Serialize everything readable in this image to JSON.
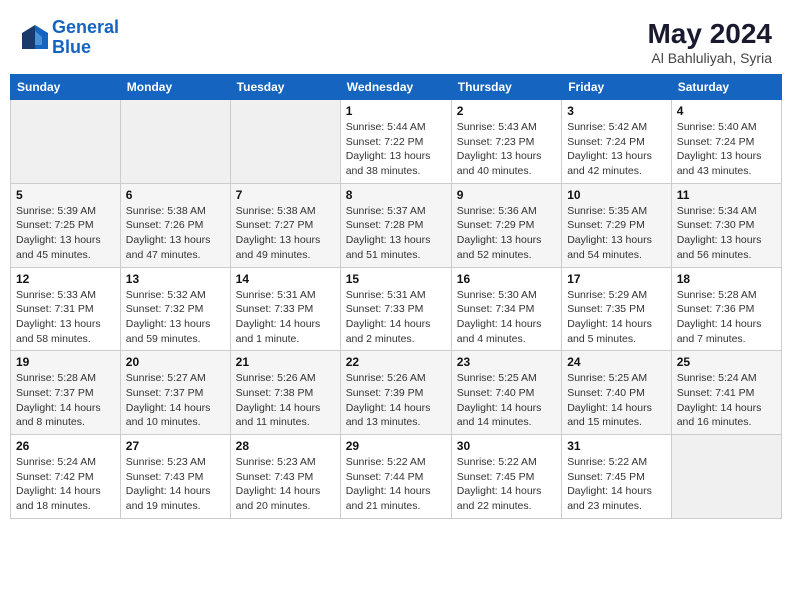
{
  "header": {
    "logo_line1": "General",
    "logo_line2": "Blue",
    "month_year": "May 2024",
    "location": "Al Bahluliyah, Syria"
  },
  "days_of_week": [
    "Sunday",
    "Monday",
    "Tuesday",
    "Wednesday",
    "Thursday",
    "Friday",
    "Saturday"
  ],
  "weeks": [
    [
      {
        "day": "",
        "sunrise": "",
        "sunset": "",
        "daylight": ""
      },
      {
        "day": "",
        "sunrise": "",
        "sunset": "",
        "daylight": ""
      },
      {
        "day": "",
        "sunrise": "",
        "sunset": "",
        "daylight": ""
      },
      {
        "day": "1",
        "sunrise": "Sunrise: 5:44 AM",
        "sunset": "Sunset: 7:22 PM",
        "daylight": "Daylight: 13 hours and 38 minutes."
      },
      {
        "day": "2",
        "sunrise": "Sunrise: 5:43 AM",
        "sunset": "Sunset: 7:23 PM",
        "daylight": "Daylight: 13 hours and 40 minutes."
      },
      {
        "day": "3",
        "sunrise": "Sunrise: 5:42 AM",
        "sunset": "Sunset: 7:24 PM",
        "daylight": "Daylight: 13 hours and 42 minutes."
      },
      {
        "day": "4",
        "sunrise": "Sunrise: 5:40 AM",
        "sunset": "Sunset: 7:24 PM",
        "daylight": "Daylight: 13 hours and 43 minutes."
      }
    ],
    [
      {
        "day": "5",
        "sunrise": "Sunrise: 5:39 AM",
        "sunset": "Sunset: 7:25 PM",
        "daylight": "Daylight: 13 hours and 45 minutes."
      },
      {
        "day": "6",
        "sunrise": "Sunrise: 5:38 AM",
        "sunset": "Sunset: 7:26 PM",
        "daylight": "Daylight: 13 hours and 47 minutes."
      },
      {
        "day": "7",
        "sunrise": "Sunrise: 5:38 AM",
        "sunset": "Sunset: 7:27 PM",
        "daylight": "Daylight: 13 hours and 49 minutes."
      },
      {
        "day": "8",
        "sunrise": "Sunrise: 5:37 AM",
        "sunset": "Sunset: 7:28 PM",
        "daylight": "Daylight: 13 hours and 51 minutes."
      },
      {
        "day": "9",
        "sunrise": "Sunrise: 5:36 AM",
        "sunset": "Sunset: 7:29 PM",
        "daylight": "Daylight: 13 hours and 52 minutes."
      },
      {
        "day": "10",
        "sunrise": "Sunrise: 5:35 AM",
        "sunset": "Sunset: 7:29 PM",
        "daylight": "Daylight: 13 hours and 54 minutes."
      },
      {
        "day": "11",
        "sunrise": "Sunrise: 5:34 AM",
        "sunset": "Sunset: 7:30 PM",
        "daylight": "Daylight: 13 hours and 56 minutes."
      }
    ],
    [
      {
        "day": "12",
        "sunrise": "Sunrise: 5:33 AM",
        "sunset": "Sunset: 7:31 PM",
        "daylight": "Daylight: 13 hours and 58 minutes."
      },
      {
        "day": "13",
        "sunrise": "Sunrise: 5:32 AM",
        "sunset": "Sunset: 7:32 PM",
        "daylight": "Daylight: 13 hours and 59 minutes."
      },
      {
        "day": "14",
        "sunrise": "Sunrise: 5:31 AM",
        "sunset": "Sunset: 7:33 PM",
        "daylight": "Daylight: 14 hours and 1 minute."
      },
      {
        "day": "15",
        "sunrise": "Sunrise: 5:31 AM",
        "sunset": "Sunset: 7:33 PM",
        "daylight": "Daylight: 14 hours and 2 minutes."
      },
      {
        "day": "16",
        "sunrise": "Sunrise: 5:30 AM",
        "sunset": "Sunset: 7:34 PM",
        "daylight": "Daylight: 14 hours and 4 minutes."
      },
      {
        "day": "17",
        "sunrise": "Sunrise: 5:29 AM",
        "sunset": "Sunset: 7:35 PM",
        "daylight": "Daylight: 14 hours and 5 minutes."
      },
      {
        "day": "18",
        "sunrise": "Sunrise: 5:28 AM",
        "sunset": "Sunset: 7:36 PM",
        "daylight": "Daylight: 14 hours and 7 minutes."
      }
    ],
    [
      {
        "day": "19",
        "sunrise": "Sunrise: 5:28 AM",
        "sunset": "Sunset: 7:37 PM",
        "daylight": "Daylight: 14 hours and 8 minutes."
      },
      {
        "day": "20",
        "sunrise": "Sunrise: 5:27 AM",
        "sunset": "Sunset: 7:37 PM",
        "daylight": "Daylight: 14 hours and 10 minutes."
      },
      {
        "day": "21",
        "sunrise": "Sunrise: 5:26 AM",
        "sunset": "Sunset: 7:38 PM",
        "daylight": "Daylight: 14 hours and 11 minutes."
      },
      {
        "day": "22",
        "sunrise": "Sunrise: 5:26 AM",
        "sunset": "Sunset: 7:39 PM",
        "daylight": "Daylight: 14 hours and 13 minutes."
      },
      {
        "day": "23",
        "sunrise": "Sunrise: 5:25 AM",
        "sunset": "Sunset: 7:40 PM",
        "daylight": "Daylight: 14 hours and 14 minutes."
      },
      {
        "day": "24",
        "sunrise": "Sunrise: 5:25 AM",
        "sunset": "Sunset: 7:40 PM",
        "daylight": "Daylight: 14 hours and 15 minutes."
      },
      {
        "day": "25",
        "sunrise": "Sunrise: 5:24 AM",
        "sunset": "Sunset: 7:41 PM",
        "daylight": "Daylight: 14 hours and 16 minutes."
      }
    ],
    [
      {
        "day": "26",
        "sunrise": "Sunrise: 5:24 AM",
        "sunset": "Sunset: 7:42 PM",
        "daylight": "Daylight: 14 hours and 18 minutes."
      },
      {
        "day": "27",
        "sunrise": "Sunrise: 5:23 AM",
        "sunset": "Sunset: 7:43 PM",
        "daylight": "Daylight: 14 hours and 19 minutes."
      },
      {
        "day": "28",
        "sunrise": "Sunrise: 5:23 AM",
        "sunset": "Sunset: 7:43 PM",
        "daylight": "Daylight: 14 hours and 20 minutes."
      },
      {
        "day": "29",
        "sunrise": "Sunrise: 5:22 AM",
        "sunset": "Sunset: 7:44 PM",
        "daylight": "Daylight: 14 hours and 21 minutes."
      },
      {
        "day": "30",
        "sunrise": "Sunrise: 5:22 AM",
        "sunset": "Sunset: 7:45 PM",
        "daylight": "Daylight: 14 hours and 22 minutes."
      },
      {
        "day": "31",
        "sunrise": "Sunrise: 5:22 AM",
        "sunset": "Sunset: 7:45 PM",
        "daylight": "Daylight: 14 hours and 23 minutes."
      },
      {
        "day": "",
        "sunrise": "",
        "sunset": "",
        "daylight": ""
      }
    ]
  ]
}
